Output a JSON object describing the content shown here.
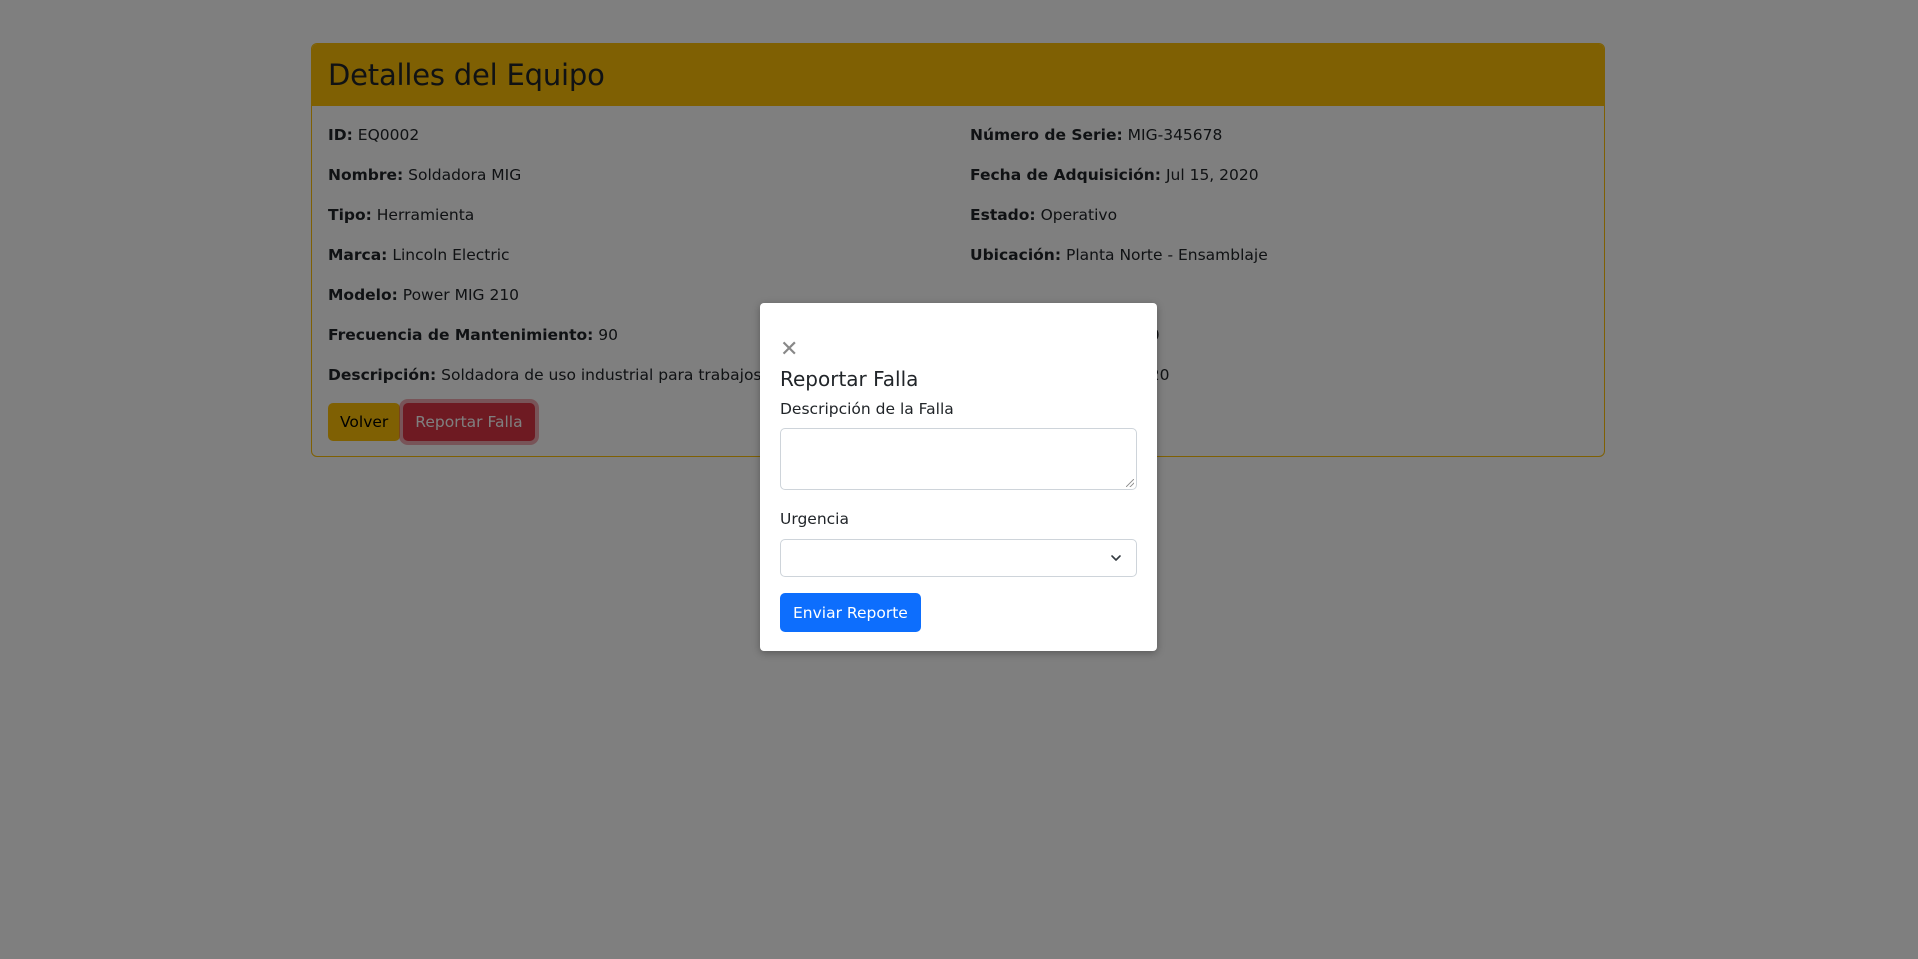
{
  "card": {
    "title": "Detalles del Equipo",
    "left_fields": [
      {
        "label": "ID:",
        "value": "EQ0002"
      },
      {
        "label": "Nombre:",
        "value": "Soldadora MIG"
      },
      {
        "label": "Tipo:",
        "value": "Herramienta"
      },
      {
        "label": "Marca:",
        "value": "Lincoln Electric"
      },
      {
        "label": "Modelo:",
        "value": "Power MIG 210"
      },
      {
        "label": "Frecuencia de Mantenimiento:",
        "value": "90"
      },
      {
        "label": "Descripción:",
        "value": "Soldadora de uso industrial para trabajos de pre"
      }
    ],
    "right_fields": [
      {
        "label": "Número de Serie:",
        "value": "MIG-345678"
      },
      {
        "label": "Fecha de Adquisición:",
        "value": "Jul 15, 2020"
      },
      {
        "label": "Estado:",
        "value": "Operativo"
      },
      {
        "label": "Ubicación:",
        "value": "Planta Norte - Ensamblaje"
      },
      {
        "label": "",
        "value": ""
      },
      {
        "label": "",
        "value": "020"
      },
      {
        "label": "",
        "value": "2020"
      }
    ],
    "back_button": "Volver",
    "report_button": "Reportar Falla"
  },
  "modal": {
    "close_glyph": "✕",
    "title": "Reportar Falla",
    "description_label": "Descripción de la Falla",
    "description_value": "",
    "urgency_label": "Urgencia",
    "urgency_selected": "",
    "submit_label": "Enviar Reporte"
  }
}
